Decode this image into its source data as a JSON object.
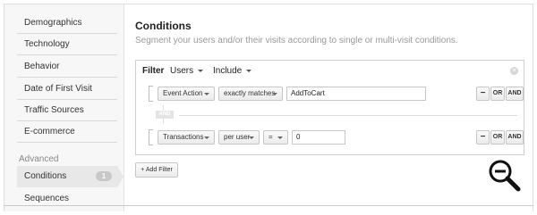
{
  "sidebar": {
    "items": [
      {
        "label": "Demographics"
      },
      {
        "label": "Technology"
      },
      {
        "label": "Behavior"
      },
      {
        "label": "Date of First Visit"
      },
      {
        "label": "Traffic Sources"
      },
      {
        "label": "E-commerce"
      }
    ],
    "group_label": "Advanced",
    "advanced_items": [
      {
        "label": "Conditions",
        "badge": "1"
      },
      {
        "label": "Sequences"
      }
    ]
  },
  "main": {
    "title": "Conditions",
    "subtitle": "Segment your users and/or their visits according to single or multi-visit conditions."
  },
  "filter": {
    "label": "Filter",
    "scope": "Users",
    "mode": "Include",
    "close_icon": "close-icon",
    "rows": [
      {
        "dimension": "Event Action",
        "operator": "exactly matches",
        "value": "AddToCart",
        "minus_label": "−",
        "or_label": "OR",
        "and_label": "AND"
      },
      {
        "dimension": "Transactions",
        "scope": "per user",
        "operator": "=",
        "value": "0",
        "minus_label": "−",
        "or_label": "OR",
        "and_label": "AND"
      }
    ],
    "and_separator": "AND"
  },
  "add_filter_label": "+ Add Filter",
  "zoom_icon": "zoom-out-icon"
}
